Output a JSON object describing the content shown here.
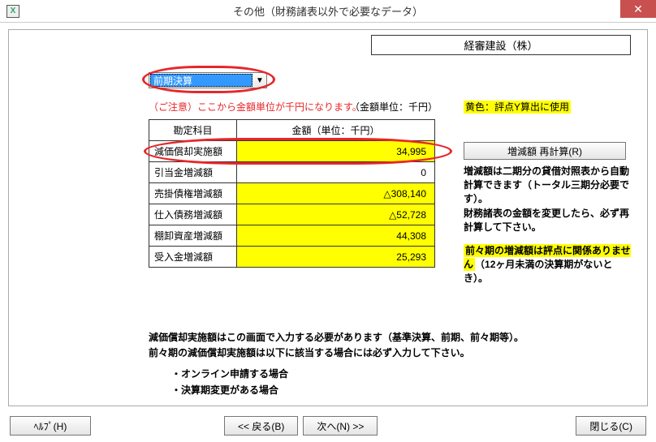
{
  "window": {
    "icon_text": "X",
    "title": "その他（財務諸表以外で必要なデータ）",
    "close_glyph": "✕"
  },
  "company": "経審建設（株）",
  "period_select": {
    "selected": "前期決算",
    "caret": "▼"
  },
  "caution_text": "（ご注意）ここから金額単位が千円になります。",
  "unit_text": "（金額単位：千円）",
  "yellow_note": "黄色：評点Y算出に使用",
  "table": {
    "header_item": "勘定科目",
    "header_amount": "金額（単位：千円）",
    "rows": [
      {
        "label": "減価償却実施額",
        "amount": "34,995",
        "yellow": true
      },
      {
        "label": "引当金増減額",
        "amount": "0",
        "yellow": false
      },
      {
        "label": "売掛債権増減額",
        "amount": "△308,140",
        "yellow": true
      },
      {
        "label": "仕入債務増減額",
        "amount": "△52,728",
        "yellow": true
      },
      {
        "label": "棚卸資産増減額",
        "amount": "44,308",
        "yellow": true
      },
      {
        "label": "受入金増減額",
        "amount": "25,293",
        "yellow": true
      }
    ]
  },
  "recalc_button": "増減額 再計算(R)",
  "side_notes": {
    "n1": "増減額は二期分の貸借対照表から自動計算できます（トータル三期分必要です）。",
    "n2": "財務諸表の金額を変更したら、必ず再計算して下さい。",
    "n3a_bold": "前々期の増減額は評点に関係ありません",
    "n3b": "（12ヶ月未満の決算期がないとき）。"
  },
  "bottom": {
    "line1": "減価償却実施額はこの画面で入力する必要があります（基準決算、前期、前々期等）。",
    "line2": "前々期の減価償却実施額は以下に該当する場合には必ず入力して下さい。",
    "b1": "・オンライン申請する場合",
    "b2": "・決算期変更がある場合"
  },
  "buttons": {
    "help": "ﾍﾙﾌﾟ(H)",
    "back": "<<  戻る(B)",
    "next": "次へ(N)  >>",
    "close": "閉じる(C)"
  }
}
